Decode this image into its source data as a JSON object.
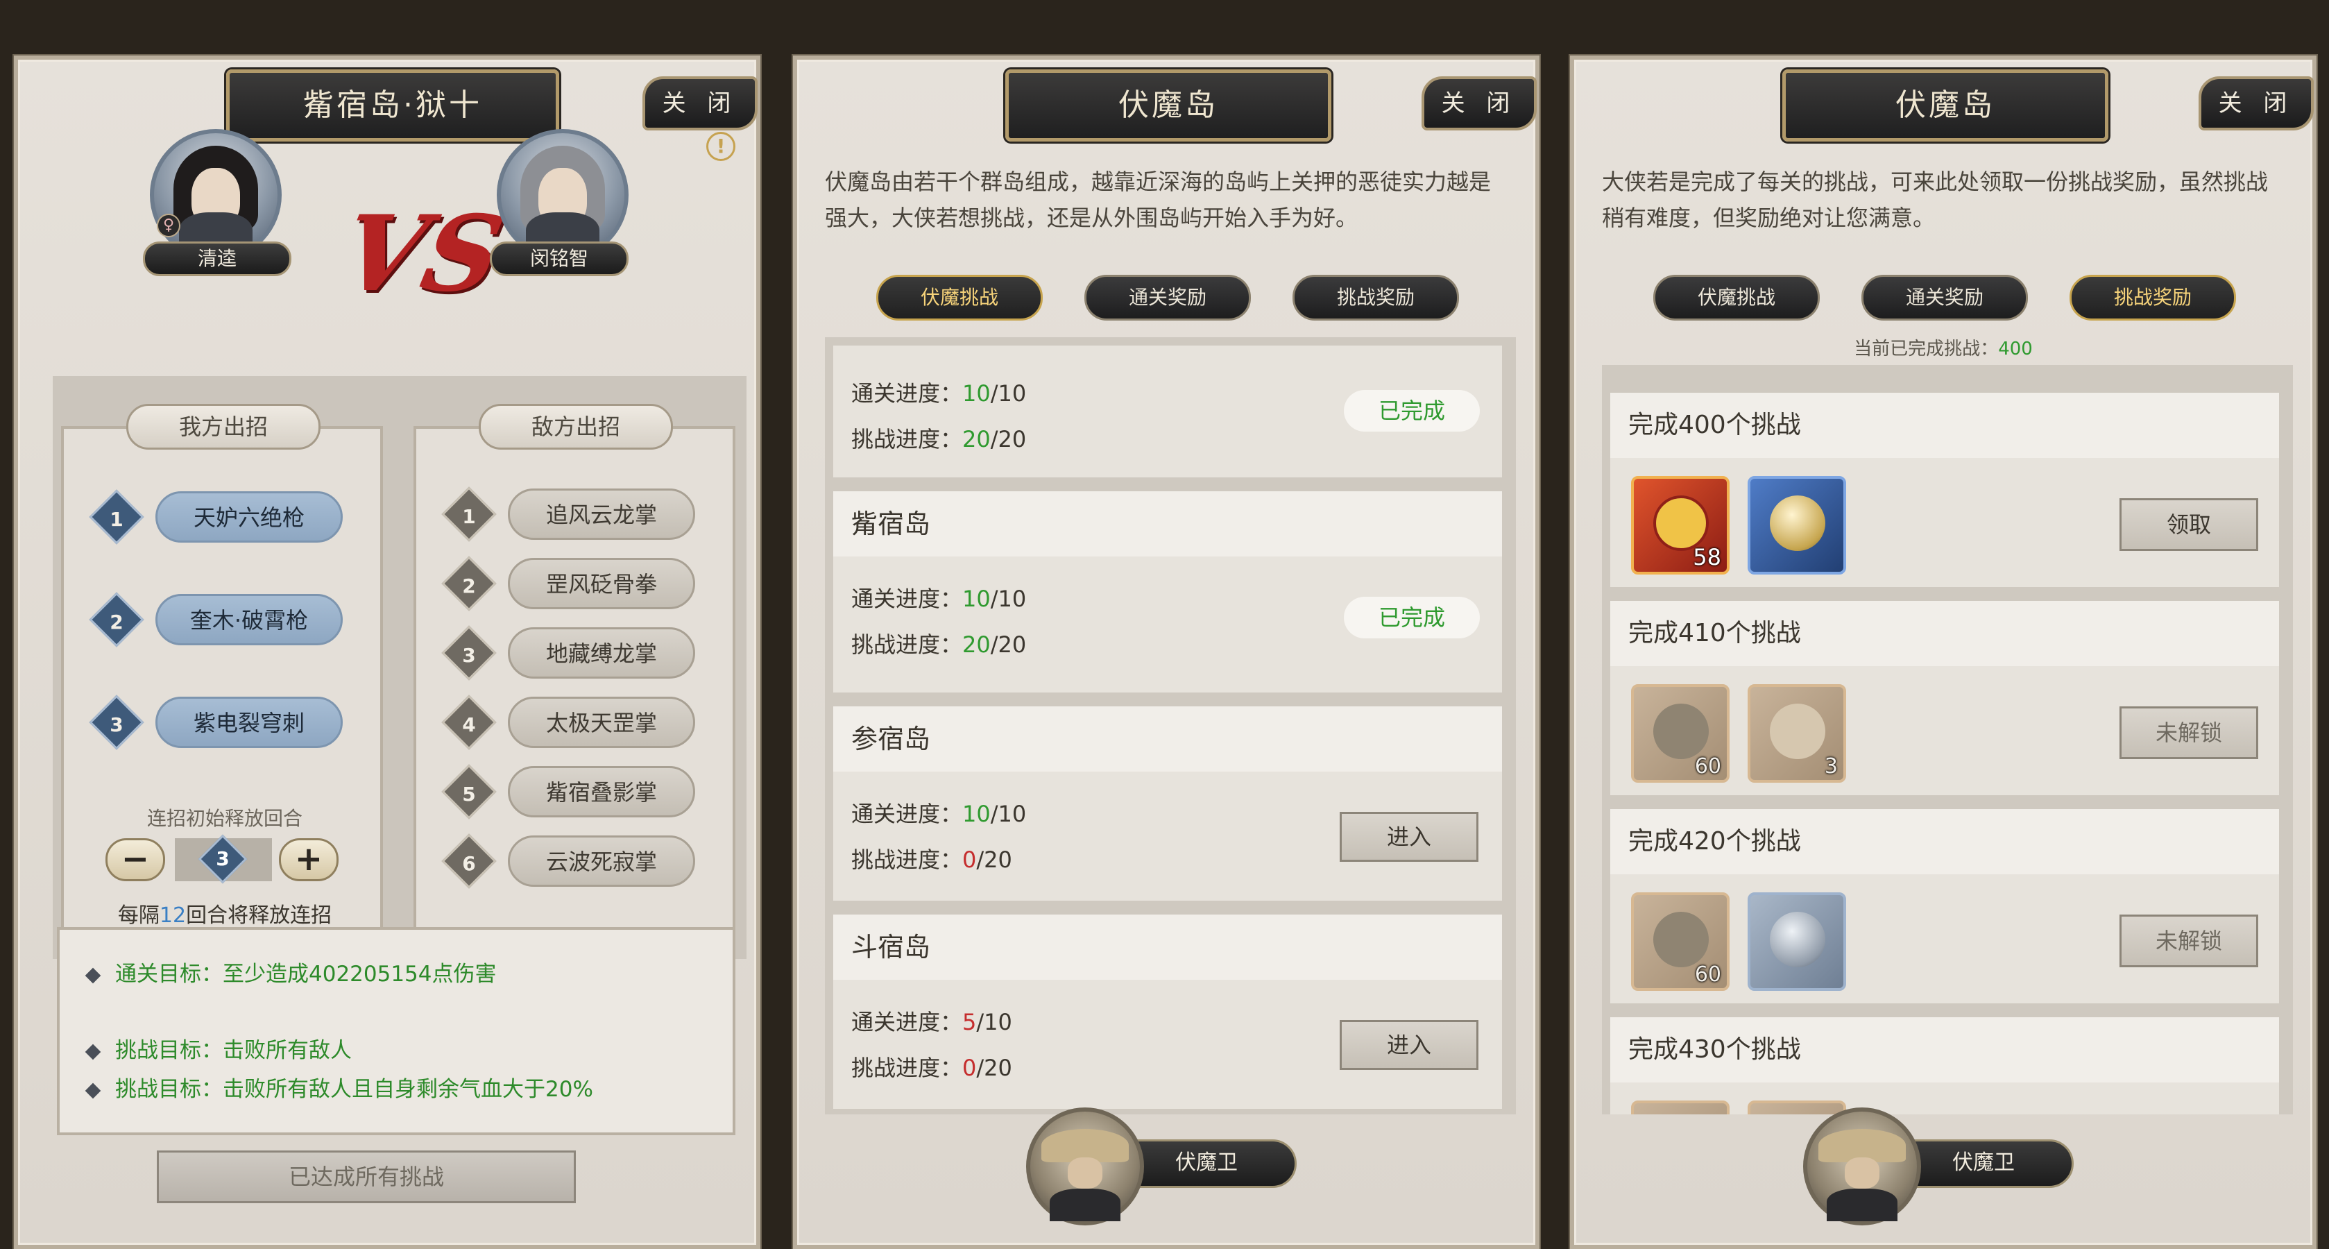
{
  "panel_a": {
    "title": "觜宿岛·狱十",
    "close": "关 闭",
    "player_name": "清逵",
    "enemy_name": "闵铭智",
    "vs": "VS",
    "info_icon": "!",
    "my_moves_tab": "我方出招",
    "enemy_moves_tab": "敌方出招",
    "my_moves": [
      {
        "num": "1",
        "name": "天妒六绝枪"
      },
      {
        "num": "2",
        "name": "奎木·破霄枪"
      },
      {
        "num": "3",
        "name": "紫电裂穹刺"
      }
    ],
    "enemy_moves": [
      {
        "num": "1",
        "name": "追风云龙掌"
      },
      {
        "num": "2",
        "name": "罡风砭骨拳"
      },
      {
        "num": "3",
        "name": "地藏缚龙掌"
      },
      {
        "num": "4",
        "name": "太极天罡掌"
      },
      {
        "num": "5",
        "name": "觜宿叠影掌"
      },
      {
        "num": "6",
        "name": "云波死寂掌"
      }
    ],
    "combo_label": "连招初始释放回合",
    "combo_value": "3",
    "minus": "−",
    "plus": "+",
    "release_prefix": "每隔",
    "release_rounds": "12",
    "release_suffix": "回合将释放连招",
    "goals": [
      "通关目标：至少造成402205154点伤害",
      "挑战目标：击败所有敌人",
      "挑战目标：击败所有敌人且自身剩余气血大于20%"
    ],
    "achieved_button": "已达成所有挑战"
  },
  "panel_b": {
    "title": "伏魔岛",
    "close": "关 闭",
    "intro": "伏魔岛由若干个群岛组成，越靠近深海的岛屿上关押的恶徒实力越是强大，大侠若想挑战，还是从外围岛屿开始入手为好。",
    "tabs": [
      "伏魔挑战",
      "通关奖励",
      "挑战奖励"
    ],
    "clear_label": "通关进度：",
    "challenge_label": "挑战进度：",
    "islands": [
      {
        "name": "",
        "clear_done": "10",
        "clear_total": "/10",
        "chal_done": "20",
        "chal_total": "/20",
        "action": "已完成"
      },
      {
        "name": "觜宿岛",
        "clear_done": "10",
        "clear_total": "/10",
        "chal_done": "20",
        "chal_total": "/20",
        "action": "已完成"
      },
      {
        "name": "参宿岛",
        "clear_done": "10",
        "clear_total": "/10",
        "chal_done": "0",
        "chal_total": "/20",
        "action": "进入"
      },
      {
        "name": "斗宿岛",
        "clear_done": "5",
        "clear_total": "/10",
        "chal_done": "0",
        "chal_total": "/20",
        "action": "进入"
      }
    ],
    "guard_name": "伏魔卫"
  },
  "panel_c": {
    "title": "伏魔岛",
    "close": "关 闭",
    "intro": "大侠若是完成了每关的挑战，可来此处领取一份挑战奖励，虽然挑战稍有难度，但奖励绝对让您满意。",
    "tabs": [
      "伏魔挑战",
      "通关奖励",
      "挑战奖励"
    ],
    "current_label": "当前已完成挑战：",
    "current_value": "400",
    "rewards": [
      {
        "title": "完成400个挑战",
        "items": [
          {
            "count": "58"
          },
          {
            "count": ""
          }
        ],
        "button": "领取"
      },
      {
        "title": "完成410个挑战",
        "items": [
          {
            "count": "60"
          },
          {
            "count": "3"
          }
        ],
        "button": "未解锁"
      },
      {
        "title": "完成420个挑战",
        "items": [
          {
            "count": "60"
          },
          {
            "count": ""
          }
        ],
        "button": "未解锁"
      },
      {
        "title": "完成430个挑战",
        "items": [],
        "button": ""
      }
    ],
    "guard_name": "伏魔卫"
  },
  "colors": {
    "success_green": "#2f9a2f",
    "warning_red": "#c52d2d",
    "active_tab_gold": "#f6d37a"
  }
}
